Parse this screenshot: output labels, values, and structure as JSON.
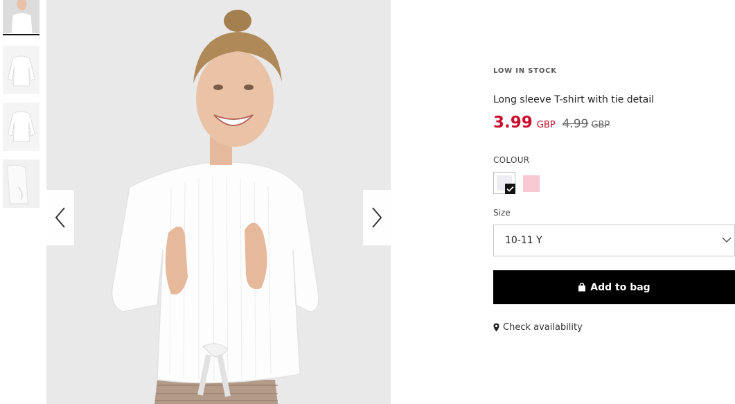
{
  "gallery": {
    "thumbnails": [
      {
        "alt": "thumbnail-1",
        "active": true
      },
      {
        "alt": "thumbnail-2",
        "active": false
      },
      {
        "alt": "thumbnail-3",
        "active": false
      },
      {
        "alt": "thumbnail-4",
        "active": false
      }
    ],
    "prev_icon": "chevron-left-icon",
    "next_icon": "chevron-right-icon"
  },
  "product": {
    "stock_status": "LOW IN STOCK",
    "title": "Long sleeve T-shirt with tie detail",
    "price_now": "3.99",
    "currency_now": "GBP",
    "price_old": "4.99",
    "currency_old": "GBP",
    "colour_label": "COLOUR",
    "colours": [
      {
        "name": "white",
        "hex": "#ececf2",
        "selected": true
      },
      {
        "name": "pink",
        "hex": "#f6c9d3",
        "selected": false
      }
    ],
    "size_label": "Size",
    "size_selected": "10-11 Y",
    "add_to_bag": "Add to bag",
    "check_availability": "Check availability"
  },
  "colors": {
    "sale_red": "#c8102e",
    "button_black": "#000000"
  }
}
